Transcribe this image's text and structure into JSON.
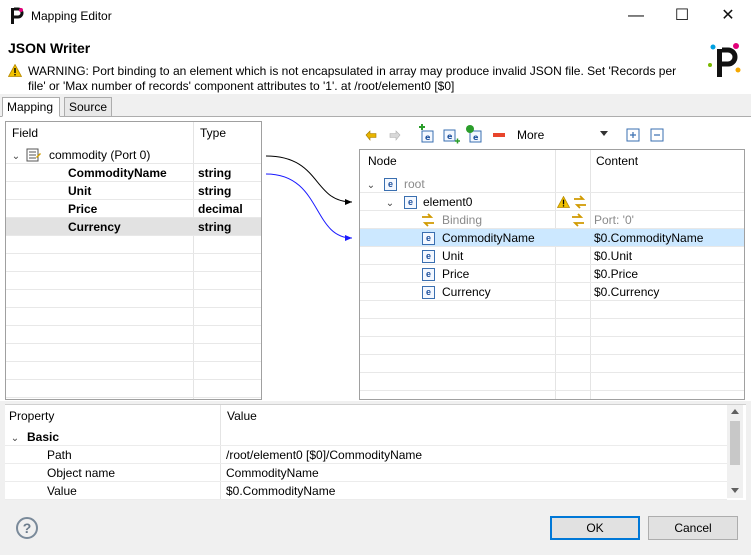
{
  "window": {
    "title": "Mapping Editor",
    "minimize": "—",
    "maximize": "☐",
    "close": "✕"
  },
  "dialog": {
    "title": "JSON Writer",
    "warning": "WARNING: Port binding to an element which is not encapsulated in array may produce invalid JSON file. Set 'Records per file' or 'Max number of records' component attributes to '1'. at /root/element0 [$0]"
  },
  "tabs": [
    {
      "label": "Mapping"
    },
    {
      "label": "Source"
    }
  ],
  "left_table": {
    "headers": {
      "field": "Field",
      "type": "Type"
    },
    "port": "commodity (Port 0)",
    "rows": [
      {
        "field": "CommodityName",
        "type": "string"
      },
      {
        "field": "Unit",
        "type": "string"
      },
      {
        "field": "Price",
        "type": "decimal"
      },
      {
        "field": "Currency",
        "type": "string"
      }
    ]
  },
  "toolbar": {
    "more_actions": "More actions"
  },
  "right_table": {
    "headers": {
      "node": "Node",
      "content": "Content"
    },
    "root": "root",
    "element0": "element0",
    "binding": {
      "label": "Binding",
      "content": "Port: '0'"
    },
    "rows": [
      {
        "node": "CommodityName",
        "content": "$0.CommodityName"
      },
      {
        "node": "Unit",
        "content": "$0.Unit"
      },
      {
        "node": "Price",
        "content": "$0.Price"
      },
      {
        "node": "Currency",
        "content": "$0.Currency"
      }
    ],
    "element_icon": "e"
  },
  "properties": {
    "headers": {
      "property": "Property",
      "value": "Value"
    },
    "group": "Basic",
    "rows": [
      {
        "property": "Path",
        "value": "/root/element0 [$0]/CommodityName"
      },
      {
        "property": "Object name",
        "value": "CommodityName"
      },
      {
        "property": "Value",
        "value": "$0.CommodityName"
      }
    ]
  },
  "footer": {
    "ok": "OK",
    "cancel": "Cancel",
    "help": "?"
  },
  "colors": {
    "accent": "#0078d7",
    "selection": "#cce8ff",
    "mapping_line_selected": "#1a1aff"
  }
}
